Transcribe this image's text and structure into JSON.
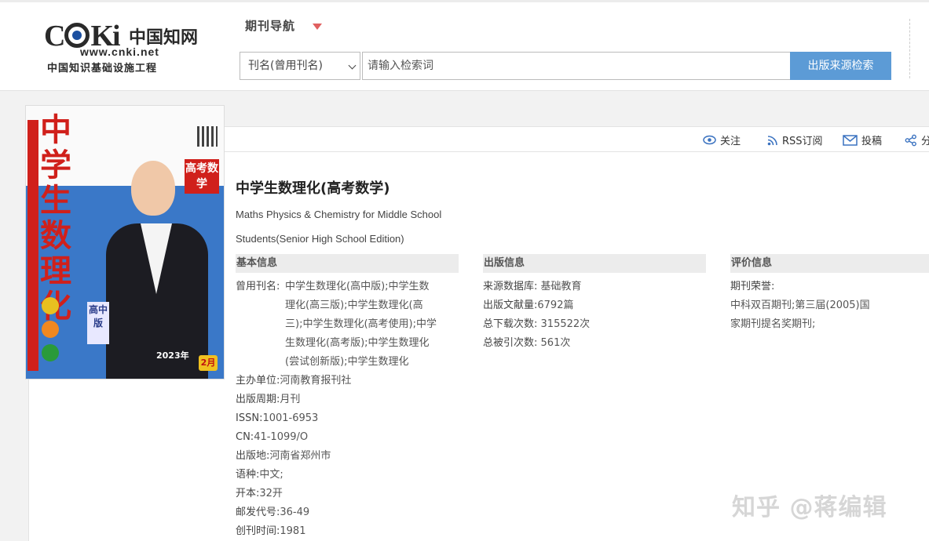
{
  "header": {
    "logo_mark": "CNKi",
    "logo_cn": "中国知网",
    "logo_url": "www.cnki.net",
    "logo_sub": "中国知识基础设施工程",
    "nav_title": "期刊导航",
    "select_value": "刊名(曾用刊名)",
    "search_placeholder": "请输入检索词",
    "search_button": "出版来源检索"
  },
  "toolbar": {
    "follow": "关注",
    "rss": "RSS订阅",
    "submit": "投稿",
    "share": "分"
  },
  "cover": {
    "title": "中学生数理化",
    "badge": "高考数学",
    "edition": "高中版",
    "year": "2023年",
    "month": "2月"
  },
  "journal": {
    "title_cn": "中学生数理化(高考数学)",
    "title_en": "Maths Physics & Chemistry for Middle School Students(Senior High School Edition)"
  },
  "basic": {
    "heading": "基本信息",
    "former_names_label": "曾用刊名:",
    "former_names": "中学生数理化(高中版);中学生数理化(高三版);中学生数理化(高三);中学生数理化(高考使用);中学生数理化(高考版);中学生数理化(尝试创新版);中学生数理化",
    "sponsor_label": "主办单位:",
    "sponsor": "河南教育报刊社",
    "cycle_label": "出版周期:",
    "cycle": "月刊",
    "issn_label": "ISSN:",
    "issn": "1001-6953",
    "cn_label": "CN:",
    "cn": "41-1099/O",
    "place_label": "出版地:",
    "place": "河南省郑州市",
    "language_label": "语种:",
    "language": "中文;",
    "format_label": "开本:",
    "format": "32开",
    "postal_label": "邮发代号:",
    "postal": "36-49",
    "founded_label": "创刊时间:",
    "founded": "1981"
  },
  "publish": {
    "heading": "出版信息",
    "source_label": "来源数据库:",
    "source": "基础教育",
    "count_label": "出版文献量:",
    "count": "6792篇",
    "downloads_label": "总下载次数:",
    "downloads": "315522次",
    "cited_label": "总被引次数:",
    "cited": "561次"
  },
  "evaluation": {
    "heading": "评价信息",
    "honor_label": "期刊荣誉:",
    "honor": "中科双百期刊;第三届(2005)国家期刊提名奖期刊;"
  },
  "watermark": "知乎 @蒋编辑",
  "colors": {
    "search_button": "#5c9bd6",
    "accent_red": "#d0201b",
    "section_bg": "#ececec"
  }
}
